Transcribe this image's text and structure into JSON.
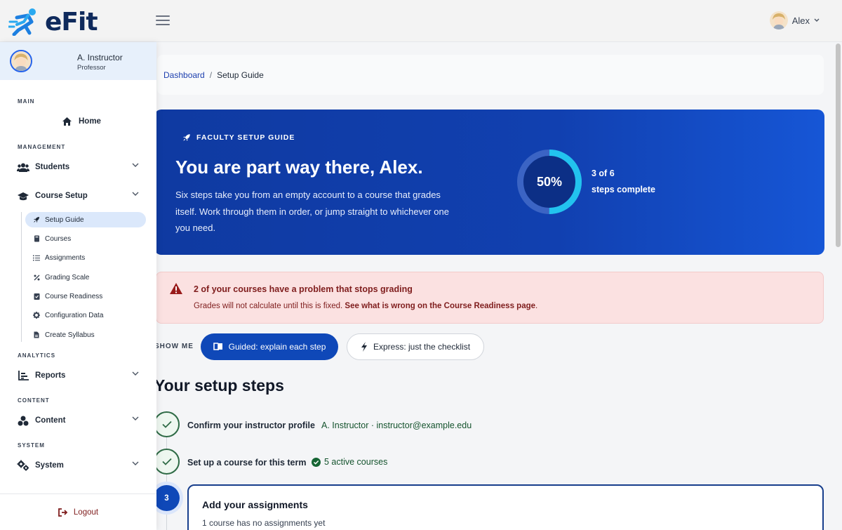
{
  "app": {
    "name": "eFit"
  },
  "header": {
    "user_name": "Alex"
  },
  "sidebar": {
    "profile": {
      "name": "A. Instructor",
      "role": "Professor"
    },
    "sections": {
      "main": "MAIN",
      "management": "MANAGEMENT",
      "analytics": "ANALYTICS",
      "content": "CONTENT",
      "system": "SYSTEM"
    },
    "items": {
      "home": "Home",
      "students": "Students",
      "course_setup": "Course Setup",
      "reports": "Reports",
      "content": "Content",
      "system": "System"
    },
    "sub_items": {
      "setup_guide": "Setup Guide",
      "courses": "Courses",
      "assignments": "Assignments",
      "grading_scale": "Grading Scale",
      "course_readiness": "Course Readiness",
      "configuration_data": "Configuration Data",
      "create_syllabus": "Create Syllabus"
    },
    "logout": "Logout"
  },
  "breadcrumb": {
    "parent": "Dashboard",
    "separator": "/",
    "current": "Setup Guide"
  },
  "hero": {
    "tag": "FACULTY SETUP GUIDE",
    "title": "You are part way there, Alex.",
    "description": "Six steps take you from an empty account to a course that grades itself. Work through them in order, or jump straight to whichever one you need.",
    "progress_percent": 50,
    "progress_label": "50%",
    "steps_count": "3 of 6",
    "steps_label": "steps complete"
  },
  "alert": {
    "title": "2 of your courses have a problem that stops grading",
    "body": "Grades will not calculate until this is fixed.",
    "link": "See what is wrong on the Course Readiness page",
    "period": "."
  },
  "mode": {
    "label": "SHOW ME",
    "guided": "Guided: explain each step",
    "express": "Express: just the checklist",
    "selected": "guided"
  },
  "steps": {
    "title": "Your setup steps",
    "step1": {
      "label": "Confirm your instructor profile",
      "meta": "A. Instructor · instructor@example.edu"
    },
    "step2": {
      "label": "Set up a course for this term",
      "meta": "5 active courses"
    },
    "step3": {
      "number": "3",
      "title": "Add your assignments",
      "desc": "1 course has no assignments yet"
    }
  },
  "colors": {
    "brand": "#0f48b8",
    "hero_bg": "#1140b0",
    "ring_accent": "#22c3ee",
    "alert_bg": "#fbe1e1",
    "alert_text": "#7f1d1d",
    "done_green": "#2f6b46"
  }
}
